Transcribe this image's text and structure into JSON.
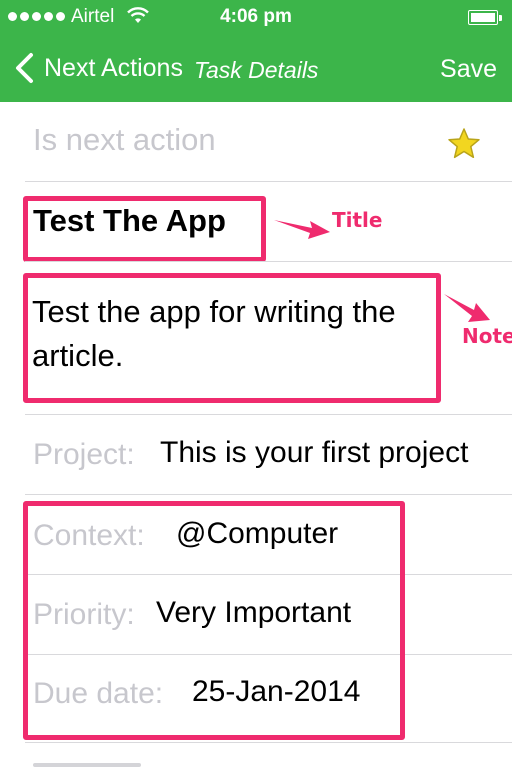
{
  "status_bar": {
    "carrier": "Airtel",
    "time": "4:06 pm"
  },
  "nav": {
    "back_label": "Next Actions",
    "title": "Task Details",
    "save_label": "Save"
  },
  "task": {
    "next_action_label": "Is next action",
    "title": "Test The App",
    "note": "Test the app for writing the article.",
    "project_label": "Project:",
    "project_value": "This is your first project",
    "context_label": "Context:",
    "context_value": "@Computer",
    "priority_label": "Priority:",
    "priority_value": "Very Important",
    "due_label": "Due date:",
    "due_value": "25-Jan-2014"
  },
  "annotations": {
    "title_label": "Title",
    "note_label": "Note",
    "color": "#ef2b6e"
  },
  "colors": {
    "nav_green": "#3cb54a",
    "star_yellow": "#f2d620"
  },
  "icons": {
    "back": "chevron-left-icon",
    "star": "star-icon",
    "wifi": "wifi-icon",
    "battery": "battery-icon"
  }
}
